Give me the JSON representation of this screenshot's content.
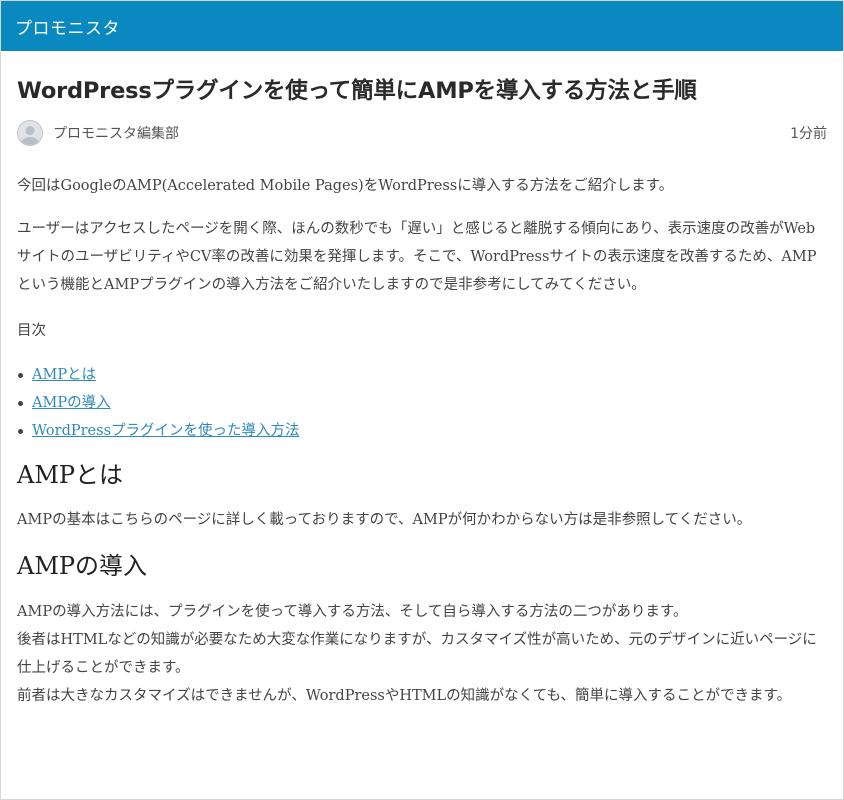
{
  "site": {
    "title": "プロモニスタ",
    "header_color": "#0a89c0"
  },
  "article": {
    "title": "WordPressプラグインを使って簡単にAMPを導入する方法と手順",
    "author": "プロモニスタ編集部",
    "avatar_icon": "user-avatar-icon",
    "time": "1分前",
    "intro": "今回はGoogleのAMP(Accelerated Mobile Pages)をWordPressに導入する方法をご紹介します。",
    "paragraph2": "ユーザーはアクセスしたページを開く際、ほんの数秒でも「遅い」と感じると離脱する傾向にあり、表示速度の改善がWebサイトのユーザビリティやCV率の改善に効果を発揮します。そこで、WordPressサイトの表示速度を改善するため、AMPという機能とAMPプラグインの導入方法をご紹介いたしますので是非参考にしてみてください。",
    "toc_label": "目次",
    "toc": [
      "AMPとは",
      "AMPの導入",
      "WordPressプラグインを使った導入方法"
    ],
    "section1": {
      "heading": "AMPとは",
      "text": "AMPの基本はこちらのページに詳しく載っておりますので、AMPが何かわからない方は是非参照してください。"
    },
    "section2": {
      "heading": "AMPの導入",
      "text": "AMPの導入方法には、プラグインを使って導入する方法、そして自ら導入する方法の二つがあります。\n後者はHTMLなどの知識が必要なため大変な作業になりますが、カスタマイズ性が高いため、元のデザインに近いページに仕上げることができます。\n前者は大きなカスタマイズはできませんが、WordPressやHTMLの知識がなくても、簡単に導入することができます。"
    },
    "link_color": "#2d8ab9"
  }
}
